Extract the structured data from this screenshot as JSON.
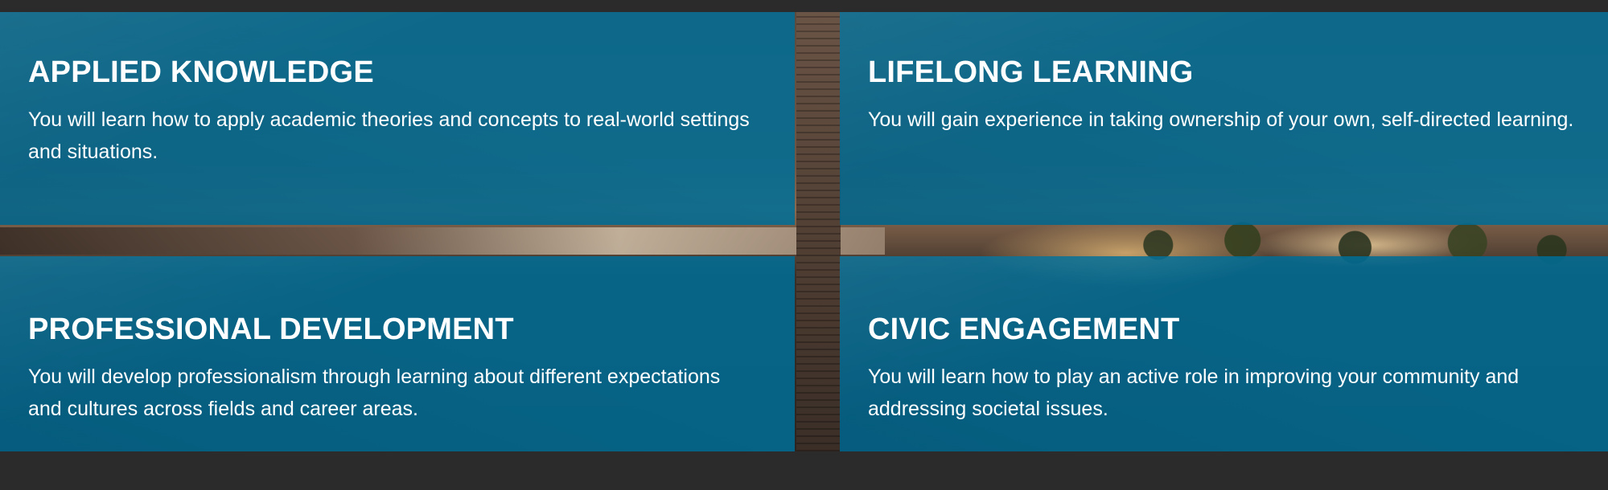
{
  "panels": [
    {
      "title": "APPLIED KNOWLEDGE",
      "description": "You will learn how to apply academic theories and concepts to real-world settings and situations."
    },
    {
      "title": "LIFELONG LEARNING",
      "description": "You will gain experience in taking ownership of your own, self-directed learning."
    },
    {
      "title": "PROFESSIONAL DEVELOPMENT",
      "description": "You will develop professionalism through learning about different expectations and cultures across fields and career areas."
    },
    {
      "title": "CIVIC ENGAGEMENT",
      "description": "You will learn how to play an active role in improving your community and addressing societal issues."
    }
  ],
  "colors": {
    "panel_overlay": "#006e96",
    "page_background": "#2b2b2b",
    "text": "#ffffff"
  }
}
